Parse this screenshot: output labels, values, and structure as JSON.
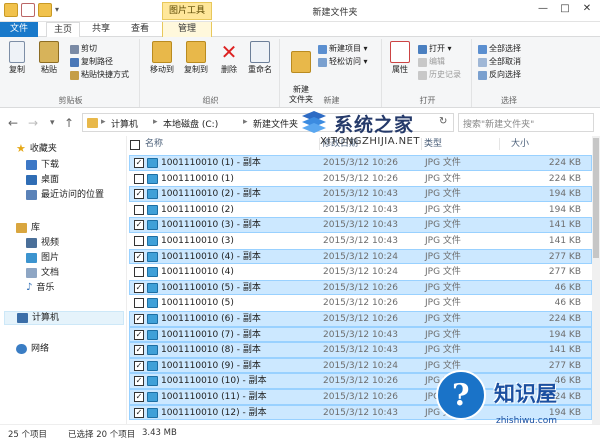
{
  "window": {
    "title": "新建文件夹",
    "context_tab_group": "图片工具",
    "minimize": "—",
    "maximize": "□",
    "close": "✕"
  },
  "tabs": [
    "文件",
    "主页",
    "共享",
    "查看",
    "管理"
  ],
  "ribbon": {
    "clipboard": {
      "label": "剪贴板",
      "copy": "复制",
      "paste": "粘贴",
      "cut": "剪切",
      "copy_path": "复制路径",
      "paste_shortcut": "粘贴快捷方式"
    },
    "organize": {
      "label": "组织",
      "move_to": "移动到",
      "copy_to": "复制到",
      "delete": "删除",
      "rename": "重命名"
    },
    "new": {
      "label": "新建",
      "new_folder": "新建\n文件夹",
      "new_item": "新建项目 ▾",
      "easy_access": "轻松访问 ▾"
    },
    "open": {
      "label": "打开",
      "properties": "属性",
      "open": "打开 ▾",
      "edit": "编辑",
      "history": "历史记录"
    },
    "select": {
      "label": "选择",
      "select_all": "全部选择",
      "select_none": "全部取消",
      "invert": "反向选择"
    }
  },
  "address": {
    "back": "←",
    "forward": "→",
    "dropdown": "▾",
    "up": "↑",
    "crumbs": [
      "计算机",
      "本地磁盘 (C:)",
      "新建文件夹"
    ],
    "sep": "▸",
    "refresh": "↻",
    "search_placeholder": "搜索\"新建文件夹\""
  },
  "nav": {
    "favorites": "收藏夹",
    "downloads": "下载",
    "desktop": "桌面",
    "recent": "最近访问的位置",
    "libraries": "库",
    "videos": "视频",
    "pictures": "图片",
    "documents": "文档",
    "music": "音乐",
    "computer": "计算机",
    "network": "网络"
  },
  "columns": {
    "name": "名称",
    "date": "修改日期",
    "type": "类型",
    "size": "大小"
  },
  "files": [
    {
      "name": "1001110010 (1) - 副本",
      "date": "2015/3/12 10:26",
      "type": "JPG 文件",
      "size": "224 KB",
      "selected": true
    },
    {
      "name": "1001110010 (1)",
      "date": "2015/3/12 10:26",
      "type": "JPG 文件",
      "size": "224 KB",
      "selected": false
    },
    {
      "name": "1001110010 (2) - 副本",
      "date": "2015/3/12 10:43",
      "type": "JPG 文件",
      "size": "194 KB",
      "selected": true
    },
    {
      "name": "1001110010 (2)",
      "date": "2015/3/12 10:43",
      "type": "JPG 文件",
      "size": "194 KB",
      "selected": false
    },
    {
      "name": "1001110010 (3) - 副本",
      "date": "2015/3/12 10:43",
      "type": "JPG 文件",
      "size": "141 KB",
      "selected": true
    },
    {
      "name": "1001110010 (3)",
      "date": "2015/3/12 10:43",
      "type": "JPG 文件",
      "size": "141 KB",
      "selected": false
    },
    {
      "name": "1001110010 (4) - 副本",
      "date": "2015/3/12 10:24",
      "type": "JPG 文件",
      "size": "277 KB",
      "selected": true
    },
    {
      "name": "1001110010 (4)",
      "date": "2015/3/12 10:24",
      "type": "JPG 文件",
      "size": "277 KB",
      "selected": false
    },
    {
      "name": "1001110010 (5) - 副本",
      "date": "2015/3/12 10:26",
      "type": "JPG 文件",
      "size": "46 KB",
      "selected": true
    },
    {
      "name": "1001110010 (5)",
      "date": "2015/3/12 10:26",
      "type": "JPG 文件",
      "size": "46 KB",
      "selected": false
    },
    {
      "name": "1001110010 (6) - 副本",
      "date": "2015/3/12 10:26",
      "type": "JPG 文件",
      "size": "224 KB",
      "selected": true
    },
    {
      "name": "1001110010 (7) - 副本",
      "date": "2015/3/12 10:43",
      "type": "JPG 文件",
      "size": "194 KB",
      "selected": true
    },
    {
      "name": "1001110010 (8) - 副本",
      "date": "2015/3/12 10:43",
      "type": "JPG 文件",
      "size": "141 KB",
      "selected": true
    },
    {
      "name": "1001110010 (9) - 副本",
      "date": "2015/3/12 10:24",
      "type": "JPG 文件",
      "size": "277 KB",
      "selected": true
    },
    {
      "name": "1001110010 (10) - 副本",
      "date": "2015/3/12 10:26",
      "type": "JPG 文件",
      "size": "46 KB",
      "selected": true
    },
    {
      "name": "1001110010 (11) - 副本",
      "date": "2015/3/12 10:26",
      "type": "JPG 文件",
      "size": "224 KB",
      "selected": true
    },
    {
      "name": "1001110010 (12) - 副本",
      "date": "2015/3/12 10:43",
      "type": "JPG 文件",
      "size": "194 KB",
      "selected": true
    }
  ],
  "status": {
    "count": "25 个项目",
    "selected": "已选择 20 个项目",
    "size": "3.43 MB"
  },
  "watermarks": {
    "brand1": "系统之家",
    "brand1_url": "XITONGZHIJIA.NET",
    "brand2": "知识屋",
    "brand2_url": "zhishiwu.com"
  },
  "colors": {
    "file_tab": "#1979ca",
    "selection": "#cce8ff",
    "selection_border": "#99d1ff",
    "context_tab": "#ffe79a",
    "folder": "#e8b84a"
  },
  "checkbox_mark": "✓"
}
